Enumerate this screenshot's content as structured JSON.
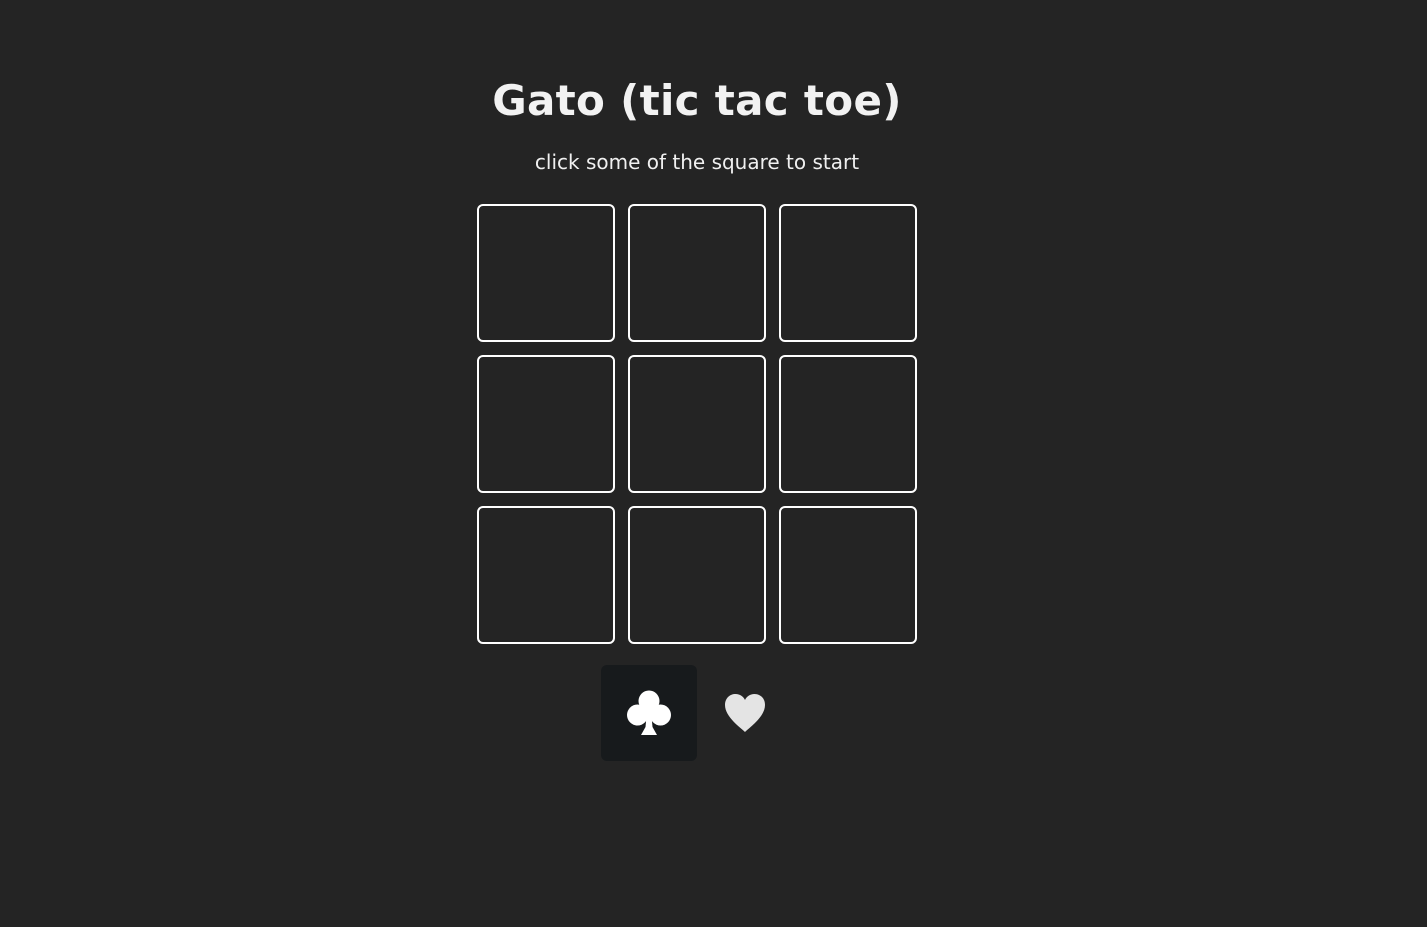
{
  "game": {
    "title": "Gato (tic tac toe)",
    "subtitle": "click some of the square to start"
  },
  "board": {
    "cells": [
      "",
      "",
      "",
      "",
      "",
      "",
      "",
      "",
      ""
    ]
  },
  "turn_indicator": {
    "players": [
      {
        "symbol": "club-icon",
        "active": true
      },
      {
        "symbol": "heart-icon",
        "active": false
      }
    ]
  },
  "colors": {
    "background": "#242424",
    "cell_border": "#ffffff",
    "active_turn_bg": "#171a1c",
    "club": "#ffffff",
    "heart": "#e4e4e4"
  }
}
